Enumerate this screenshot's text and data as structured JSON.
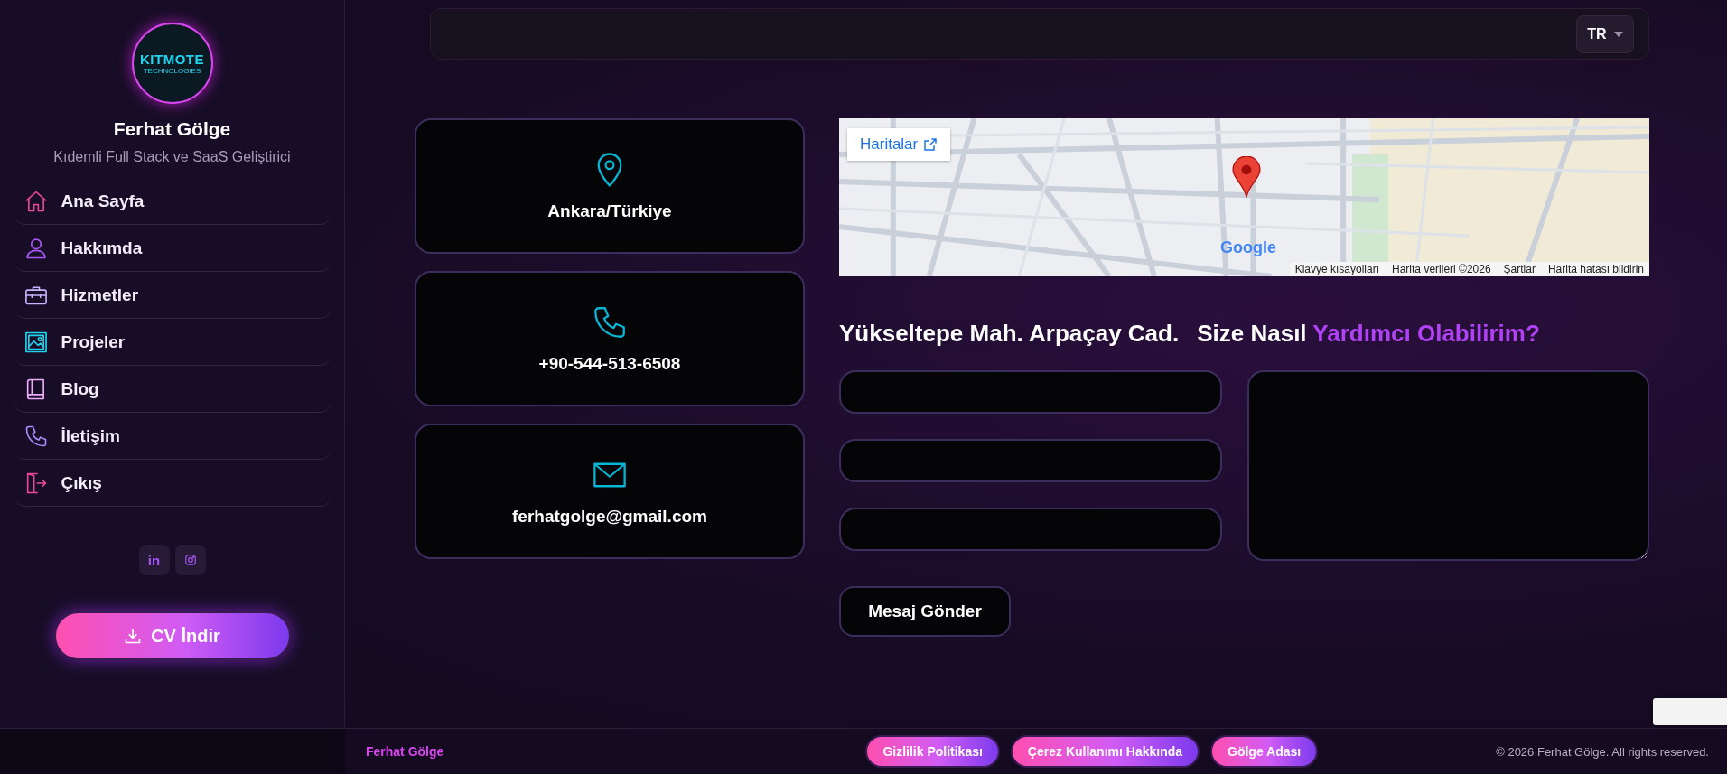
{
  "sidebar": {
    "logo": {
      "line1": "KITMOTE",
      "line2": "TECHNOLOGIES"
    },
    "name": "Ferhat Gölge",
    "subtitle": "Kıdemli Full Stack ve SaaS Geliştirici",
    "nav": [
      {
        "label": "Ana Sayfa",
        "kind": "home",
        "selected": false
      },
      {
        "label": "Hakkımda",
        "kind": "user",
        "selected": false
      },
      {
        "label": "Hizmetler",
        "kind": "briefcase",
        "selected": false
      },
      {
        "label": "Projeler",
        "kind": "image",
        "selected": false
      },
      {
        "label": "Blog",
        "kind": "book",
        "selected": false
      },
      {
        "label": "İletişim",
        "kind": "phone",
        "selected": false
      },
      {
        "label": "Çıkış",
        "kind": "logout",
        "selected": false
      }
    ],
    "social": [
      {
        "kind": "linkedin",
        "label": "in"
      },
      {
        "kind": "instagram"
      }
    ],
    "cv_button": "CV İndir"
  },
  "header": {
    "language": "TR"
  },
  "contact_cards": [
    {
      "kind": "location",
      "text": "Ankara/Türkiye"
    },
    {
      "kind": "phone",
      "text": "+90-544-513-6508"
    },
    {
      "kind": "mail",
      "text": "ferhatgolge@gmail.com"
    }
  ],
  "map": {
    "open_link": "Haritalar",
    "logo": "Google",
    "attribution": [
      "Klavye kısayolları",
      "Harita verileri ©2026",
      "Şartlar",
      "Harita hatası bildirin"
    ]
  },
  "address": "Yükseltepe Mah. Arpaçay Cad.",
  "form": {
    "title_lead": "Size Nasıl",
    "title_highlight": "Yardımcı Olabilirim?",
    "submit": "Mesaj Gönder"
  },
  "footer": {
    "brand": "Ferhat Gölge",
    "links": [
      "Gizlilik Politikası",
      "Çerez Kullanımı Hakkında",
      "Gölge Adası"
    ],
    "copyright": "© 2026 Ferhat Gölge. All rights reserved."
  }
}
